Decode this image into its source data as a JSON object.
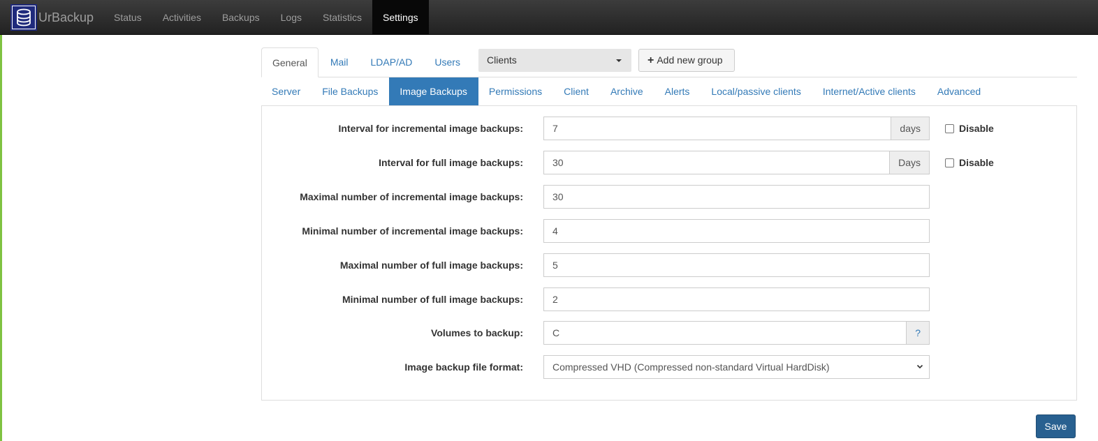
{
  "brand": {
    "name": "UrBackup",
    "logo_icon": "database-icon"
  },
  "nav": {
    "items": [
      {
        "label": "Status",
        "active": false
      },
      {
        "label": "Activities",
        "active": false
      },
      {
        "label": "Backups",
        "active": false
      },
      {
        "label": "Logs",
        "active": false
      },
      {
        "label": "Statistics",
        "active": false
      },
      {
        "label": "Settings",
        "active": true
      }
    ]
  },
  "settings": {
    "top_tabs": [
      "General",
      "Mail",
      "LDAP/AD",
      "Users"
    ],
    "active_top_tab": "General",
    "group_select": {
      "value": "Clients"
    },
    "add_group_label": "Add new group",
    "sub_tabs": [
      "Server",
      "File Backups",
      "Image Backups",
      "Permissions",
      "Client",
      "Archive",
      "Alerts",
      "Local/passive clients",
      "Internet/Active clients",
      "Advanced"
    ],
    "active_sub_tab": "Image Backups"
  },
  "form": {
    "incr_interval": {
      "label": "Interval for incremental image backups:",
      "value": "7",
      "unit": "days",
      "disable_label": "Disable",
      "disabled": false
    },
    "full_interval": {
      "label": "Interval for full image backups:",
      "value": "30",
      "unit": "Days",
      "disable_label": "Disable",
      "disabled": false
    },
    "max_incr": {
      "label": "Maximal number of incremental image backups:",
      "value": "30"
    },
    "min_incr": {
      "label": "Minimal number of incremental image backups:",
      "value": "4"
    },
    "max_full": {
      "label": "Maximal number of full image backups:",
      "value": "5"
    },
    "min_full": {
      "label": "Minimal number of full image backups:",
      "value": "2"
    },
    "volumes": {
      "label": "Volumes to backup:",
      "value": "C",
      "help": "?"
    },
    "format": {
      "label": "Image backup file format:",
      "value": "Compressed VHD (Compressed non-standard Virtual HardDisk)"
    }
  },
  "save_label": "Save",
  "colors": {
    "primary": "#337ab7",
    "nav_bg": "#222222",
    "accent": "#7fc241",
    "brand": "#1f2a7c"
  }
}
